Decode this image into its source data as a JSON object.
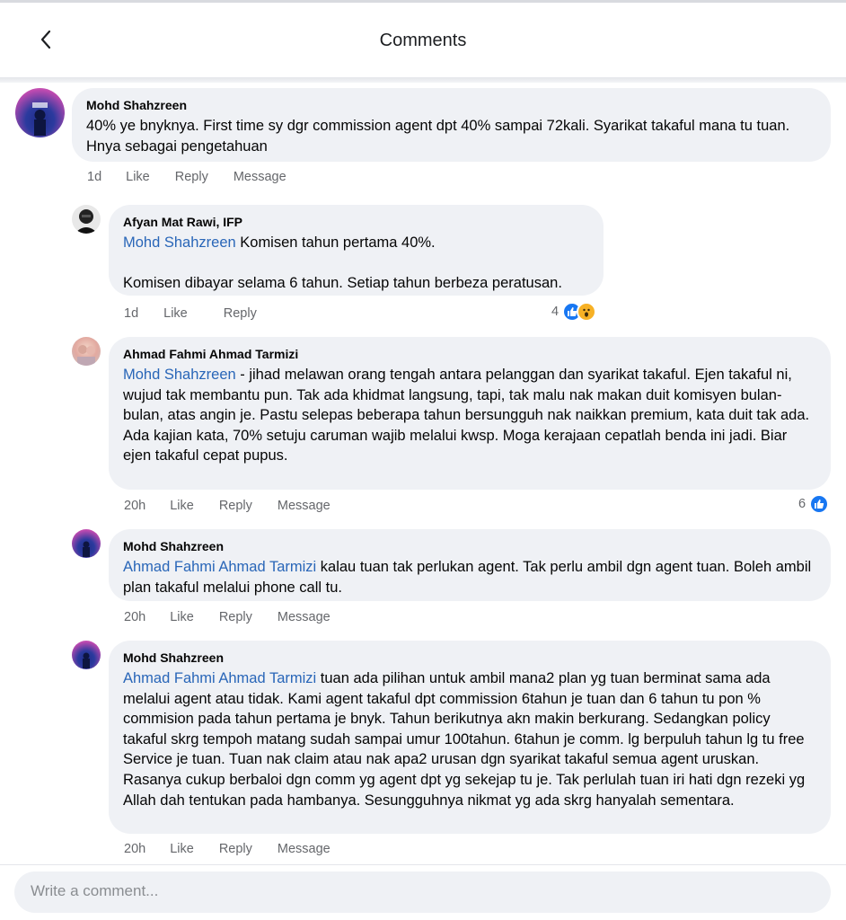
{
  "header": {
    "title": "Comments"
  },
  "comments": [
    {
      "author": "Mohd Shahzreen",
      "mention": "",
      "text": "40% ye bnyknya. First time sy dgr commission agent dpt 40% sampai 72kali. Syarikat takaful mana tu tuan. Hnya sebagai pengetahuan",
      "time": "1d",
      "like": "Like",
      "reply": "Reply",
      "message": "Message"
    },
    {
      "author": "Afyan Mat Rawi, IFP",
      "mention": "Mohd Shahzreen",
      "text": " Komisen tahun pertama 40%.\n\nKomisen dibayar selama 6 tahun. Setiap tahun berbeza peratusan.",
      "time": "1d",
      "like": "Like",
      "reply": "Reply",
      "reaction_count": "4",
      "reaction_colors": {
        "like": "#1877f2",
        "wow": "#f7b125"
      }
    },
    {
      "author": "Ahmad Fahmi Ahmad Tarmizi",
      "mention": "Mohd Shahzreen",
      "text": " - jihad melawan orang tengah antara pelanggan dan syarikat takaful. Ejen takaful ni, wujud tak membantu pun. Tak ada khidmat langsung, tapi, tak malu nak makan duit komisyen bulan-bulan, atas angin je. Pastu selepas beberapa tahun bersungguh nak naikkan premium, kata duit tak ada.\nAda kajian kata, 70% setuju caruman wajib melalui kwsp. Moga kerajaan cepatlah benda ini jadi. Biar ejen takaful cepat pupus.",
      "time": "20h",
      "like": "Like",
      "reply": "Reply",
      "message": "Message",
      "reaction_count": "6"
    },
    {
      "author": "Mohd Shahzreen",
      "mention": "Ahmad Fahmi Ahmad Tarmizi",
      "text": " kalau tuan tak perlukan agent. Tak perlu ambil dgn agent tuan. Boleh ambil plan takaful melalui phone call tu.",
      "time": "20h",
      "like": "Like",
      "reply": "Reply",
      "message": "Message"
    },
    {
      "author": "Mohd Shahzreen",
      "mention": "Ahmad Fahmi Ahmad Tarmizi",
      "text": " tuan ada pilihan untuk ambil mana2 plan yg tuan berminat sama ada melalui agent atau tidak. Kami agent takaful dpt commission 6tahun je tuan dan 6 tahun tu pon % commision pada tahun pertama je bnyk. Tahun berikutnya akn makin berkurang. Sedangkan policy takaful skrg tempoh matang sudah sampai umur 100tahun. 6tahun je comm. lg berpuluh tahun lg tu free Service je tuan. Tuan nak claim atau nak apa2 urusan dgn syarikat takaful semua agent uruskan. Rasanya cukup berbaloi dgn comm yg agent dpt yg sekejap tu je. Tak perlulah tuan iri hati dgn rezeki yg Allah dah tentukan pada hambanya. Sesungguhnya nikmat yg ada skrg hanyalah sementara.",
      "time": "20h",
      "like": "Like",
      "reply": "Reply",
      "message": "Message"
    }
  ],
  "composer": {
    "placeholder": "Write a comment..."
  }
}
